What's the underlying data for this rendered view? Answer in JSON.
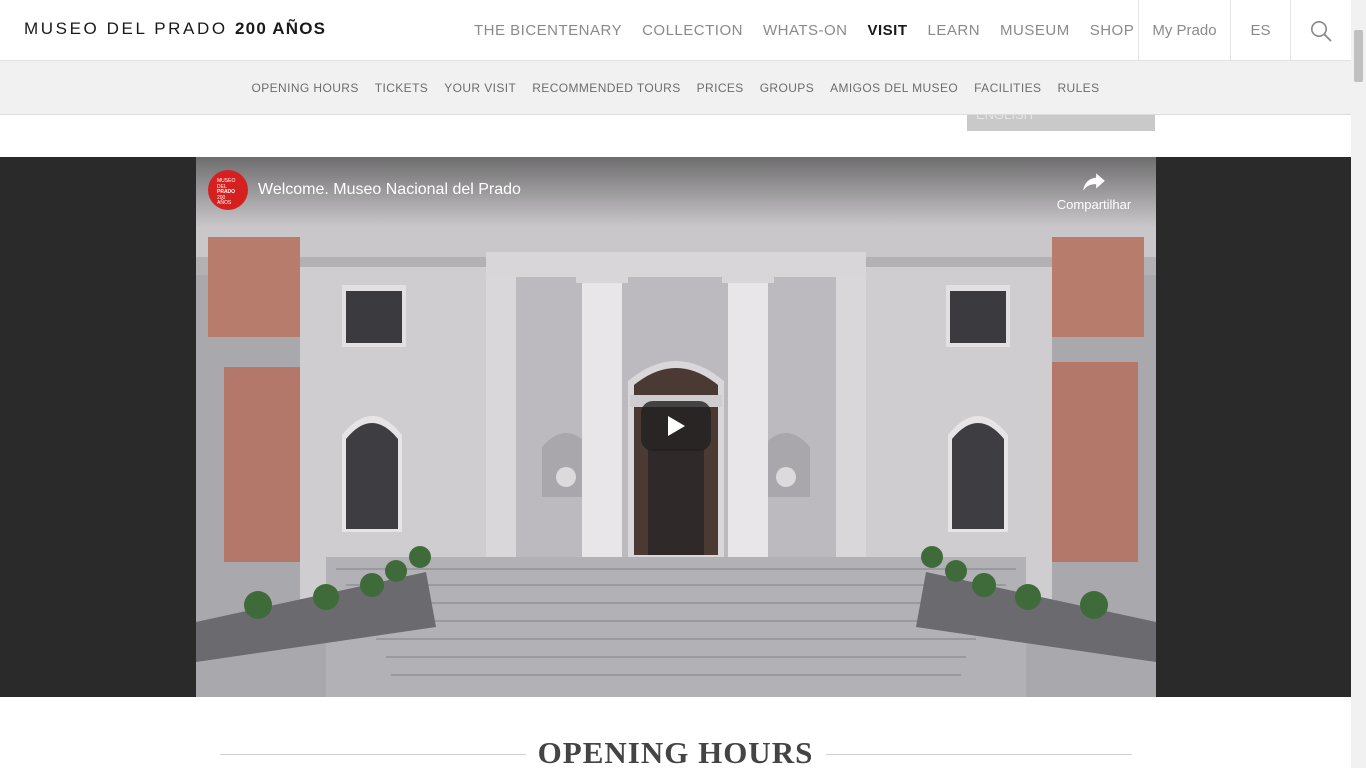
{
  "header": {
    "brand_name": "MUSEO DEL PRADO",
    "brand_suffix": "200 AÑOS",
    "nav": [
      {
        "label": "THE BICENTENARY"
      },
      {
        "label": "COLLECTION"
      },
      {
        "label": "WHATS-ON"
      },
      {
        "label": "VISIT"
      },
      {
        "label": "LEARN"
      },
      {
        "label": "MUSEUM"
      },
      {
        "label": "SHOP"
      }
    ],
    "my_prado": "My Prado",
    "language": "ES",
    "search_icon": "search-icon"
  },
  "subnav": {
    "items": [
      {
        "label": "OPENING HOURS"
      },
      {
        "label": "TICKETS"
      },
      {
        "label": "YOUR VISIT"
      },
      {
        "label": "RECOMMENDED TOURS"
      },
      {
        "label": "PRICES"
      },
      {
        "label": "GROUPS"
      },
      {
        "label": "AMIGOS DEL MUSEO"
      },
      {
        "label": "FACILITIES"
      },
      {
        "label": "RULES"
      }
    ]
  },
  "language_selector": {
    "value": "ENGLISH"
  },
  "video": {
    "title": "Welcome. Museo Nacional del Prado",
    "share_label": "Compartilhar",
    "channel_logo_lines": [
      "MUSEO",
      "DEL",
      "PRADO",
      "200",
      "AÑOS"
    ],
    "play_icon": "play-icon"
  },
  "section": {
    "heading": "OPENING HOURS"
  },
  "colors": {
    "channel_red": "#d6201f",
    "video_band": "#2a2a2a",
    "subnav_bg": "#f1f1f1"
  }
}
